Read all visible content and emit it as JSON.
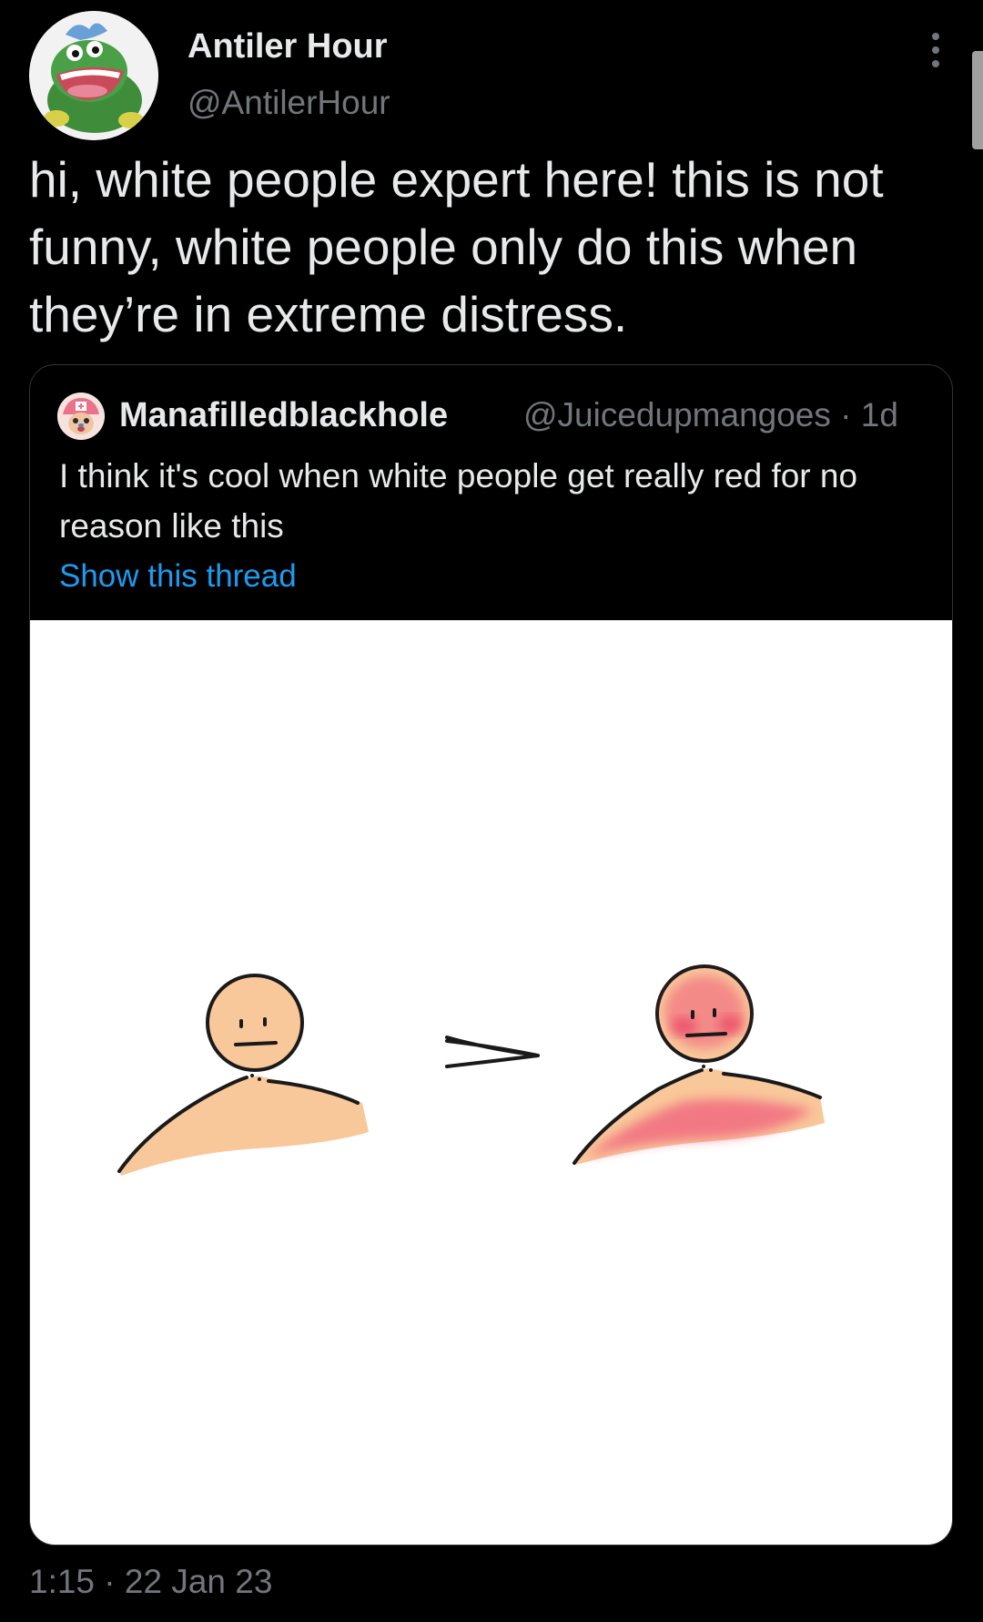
{
  "author": {
    "name": "Antiler Hour",
    "handle": "@AntilerHour",
    "avatar_icon": "green-dinosaur-plush-avatar"
  },
  "tweet": {
    "text": "hi, white people expert here! this is not funny, white people only do this when they’re in extreme distress.",
    "timestamp": "1:15 · 22 Jan 23"
  },
  "quoted_tweet": {
    "name": "Manafilledblackhole",
    "handle": "@Juicedupmangoes",
    "age": "1d",
    "handle_line": "@Juicedupmangoes · 1d",
    "avatar_icon": "anime-character-pink-hat-avatar",
    "text": "I think it's cool when white people get really red for no reason like this",
    "show_thread": "Show this thread"
  },
  "colors": {
    "background": "#000000",
    "primary_text": "#e7e9ea",
    "secondary_text": "#71767b",
    "link": "#1d9bf0",
    "card_border": "#2f3336",
    "skin": "#f9c89a",
    "blush": "#f0587a"
  },
  "icons": {
    "more": "more-vertical-icon",
    "arrow": "arrow-right-icon"
  }
}
